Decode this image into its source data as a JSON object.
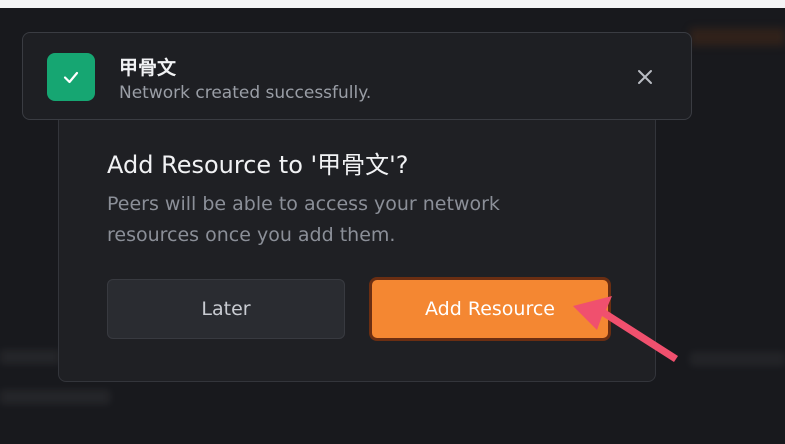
{
  "toast": {
    "title": "甲骨文",
    "message": "Network created successfully.",
    "icon": "check-icon",
    "close_icon": "close-icon"
  },
  "modal": {
    "title": "Add Resource to '甲骨文'?",
    "description": "Peers will be able to access your network resources once you add them.",
    "later_label": "Later",
    "add_label": "Add Resource"
  },
  "colors": {
    "accent": "#f48732",
    "success": "#16a672",
    "annotation_arrow": "#f0506e"
  }
}
